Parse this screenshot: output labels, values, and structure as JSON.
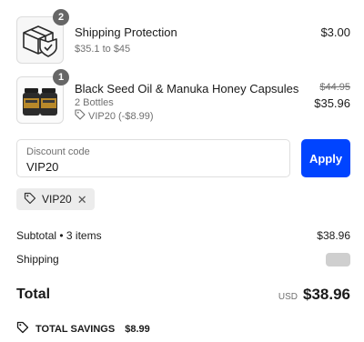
{
  "line_items": [
    {
      "title": "Shipping Protection",
      "subtitle": "$35.1 to $45",
      "quantity": "2",
      "price": "$3.00",
      "icon": "package-shield-icon"
    },
    {
      "title": "Black Seed Oil & Manuka Honey Capsules",
      "variant": "2 Bottles",
      "discount_applied": "VIP20 (-$8.99)",
      "quantity": "1",
      "compare_price": "$44.95",
      "price": "$35.96",
      "icon": "capsule-bottles-image"
    }
  ],
  "discount": {
    "label": "Discount code",
    "value": "VIP20",
    "apply_label": "Apply",
    "applied_code": "VIP20"
  },
  "summary": {
    "subtotal_label": "Subtotal • 3 items",
    "subtotal_value": "$38.96",
    "shipping_label": "Shipping",
    "total_label": "Total",
    "currency": "USD",
    "total_value": "$38.96",
    "savings_label": "TOTAL SAVINGS",
    "savings_value": "$8.99"
  },
  "colors": {
    "accent": "#0044ff",
    "badge": "#666666",
    "muted_text": "#707070",
    "chip_bg": "#ececec"
  }
}
